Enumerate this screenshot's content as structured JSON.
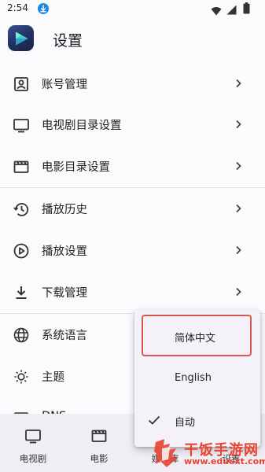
{
  "status_bar": {
    "time": "2:54"
  },
  "header": {
    "title": "设置"
  },
  "settings": {
    "groups": [
      {
        "items": [
          {
            "label": "账号管理",
            "icon": "account-box-icon"
          },
          {
            "label": "电视剧目录设置",
            "icon": "tv-icon"
          },
          {
            "label": "电影目录设置",
            "icon": "movie-icon"
          }
        ]
      },
      {
        "items": [
          {
            "label": "播放历史",
            "icon": "history-icon"
          },
          {
            "label": "播放设置",
            "icon": "play-circle-icon"
          },
          {
            "label": "下载管理",
            "icon": "download-icon"
          }
        ]
      },
      {
        "items": [
          {
            "label": "系统语言",
            "icon": "globe-icon"
          },
          {
            "label": "主题",
            "icon": "brightness-icon"
          },
          {
            "label": "DNS",
            "icon": "dns-icon"
          }
        ]
      }
    ]
  },
  "language_menu": {
    "options": [
      {
        "label": "简体中文",
        "highlighted": true,
        "selected": false
      },
      {
        "label": "English",
        "highlighted": false,
        "selected": false
      },
      {
        "label": "自动",
        "highlighted": false,
        "selected": true
      }
    ]
  },
  "bottom_nav": {
    "items": [
      {
        "label": "电视剧",
        "icon": "tv-icon"
      },
      {
        "label": "电影",
        "icon": "movie-icon"
      },
      {
        "label": "媒体库",
        "icon": "library-icon"
      },
      {
        "label": "设置",
        "icon": "settings-icon"
      }
    ]
  },
  "watermark": {
    "text": "干饭手游网",
    "url": "www.eduext.com"
  },
  "colors": {
    "accent": "#d9574e",
    "watermark": "#e8432f",
    "nav_bg": "#f0eef4",
    "menu_bg": "#f4f2f8"
  }
}
